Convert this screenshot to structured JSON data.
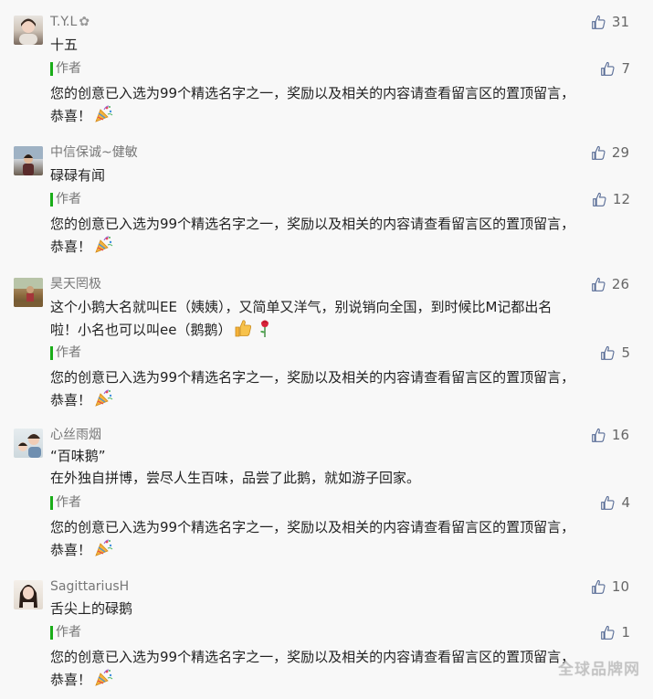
{
  "comments": [
    {
      "nickname": "T.Y.L",
      "badge_icon": "flower-badge-icon",
      "likes": "31",
      "text_lines": [
        "十五"
      ],
      "reply": {
        "author": "作者",
        "likes": "7",
        "text_lines": [
          "您的创意已入选为99个精选名字之一，奖励以及相关的内容请查看留言区的置顶留言，",
          "恭喜！"
        ],
        "emoji": "party-popper-icon"
      }
    },
    {
      "nickname": "中信保诚~健敏",
      "likes": "29",
      "text_lines": [
        "碌碌有闻"
      ],
      "reply": {
        "author": "作者",
        "likes": "12",
        "text_lines": [
          "您的创意已入选为99个精选名字之一，奖励以及相关的内容请查看留言区的置顶留言，",
          "恭喜！"
        ],
        "emoji": "party-popper-icon"
      }
    },
    {
      "nickname": "昊天罔极",
      "likes": "26",
      "text_lines": [
        "这个小鹅大名就叫EE（姨姨），又简单又洋气，别说销向全国，到时候比M记都出名",
        "啦！小名也可以叫ee（鹅鹅）"
      ],
      "trailing_icons": [
        "thumbs-up-emoji-icon",
        "rose-emoji-icon"
      ],
      "reply": {
        "author": "作者",
        "likes": "5",
        "text_lines": [
          "您的创意已入选为99个精选名字之一，奖励以及相关的内容请查看留言区的置顶留言，",
          "恭喜！"
        ],
        "emoji": "party-popper-icon"
      }
    },
    {
      "nickname": "心丝雨烟",
      "likes": "16",
      "text_lines": [
        "“百味鹅”",
        "在外独自拼博，尝尽人生百味，品尝了此鹅，就如游子回家。"
      ],
      "reply": {
        "author": "作者",
        "likes": "4",
        "text_lines": [
          "您的创意已入选为99个精选名字之一，奖励以及相关的内容请查看留言区的置顶留言，",
          "恭喜！"
        ],
        "emoji": "party-popper-icon"
      }
    },
    {
      "nickname": "SagittariusH",
      "likes": "10",
      "text_lines": [
        "舌尖上的碌鹅"
      ],
      "reply": {
        "author": "作者",
        "likes": "1",
        "text_lines": [
          "您的创意已入选为99个精选名字之一，奖励以及相关的内容请查看留言区的置顶留言，",
          "恭喜！"
        ],
        "emoji": "party-popper-icon"
      }
    }
  ],
  "watermark": "全球品牌网",
  "colors": {
    "author_bar": "#1aad19",
    "meta_text": "#777777",
    "body_text": "#222222",
    "background": "#f8f8f8"
  }
}
